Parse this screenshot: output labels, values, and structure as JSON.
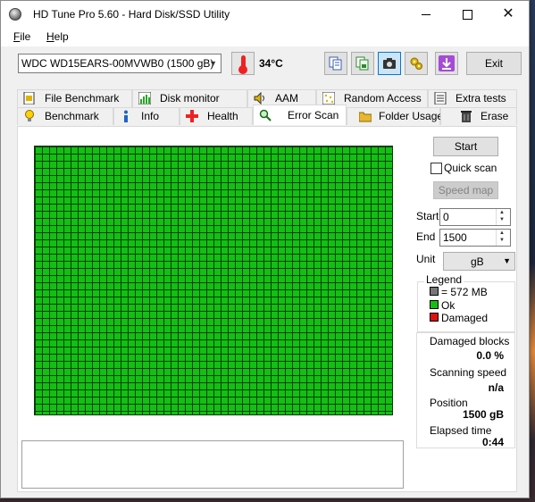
{
  "window": {
    "title": "HD Tune Pro 5.60 - Hard Disk/SSD Utility"
  },
  "menu": {
    "file_label": "File",
    "file_underline": "F",
    "file_rest": "ile",
    "help_label": "Help",
    "help_underline": "H",
    "help_rest": "elp"
  },
  "toolbar": {
    "drive": "WDC WD15EARS-00MVWB0 (1500 gB)",
    "temperature": "34°C",
    "exit_label": "Exit"
  },
  "tabs_top": [
    {
      "label": "File Benchmark",
      "icon": "file-benchmark-icon"
    },
    {
      "label": "Disk monitor",
      "icon": "disk-monitor-icon"
    },
    {
      "label": "AAM",
      "icon": "speaker-icon"
    },
    {
      "label": "Random Access",
      "icon": "random-access-icon"
    },
    {
      "label": "Extra tests",
      "icon": "extra-tests-icon"
    }
  ],
  "tabs_bottom": [
    {
      "label": "Benchmark",
      "icon": "lightbulb-icon"
    },
    {
      "label": "Info",
      "icon": "info-icon"
    },
    {
      "label": "Health",
      "icon": "health-cross-icon"
    },
    {
      "label": "Error Scan",
      "icon": "magnifier-icon",
      "selected": true
    },
    {
      "label": "Folder Usage",
      "icon": "folder-icon"
    },
    {
      "label": "Erase",
      "icon": "trash-icon"
    }
  ],
  "scan": {
    "start_label": "Start",
    "quick_scan_label": "Quick scan",
    "quick_scan_checked": false,
    "speed_map_label": "Speed map",
    "start_field_label": "Start",
    "start_value": "0",
    "end_field_label": "End",
    "end_value": "1500",
    "unit_label": "Unit",
    "unit_value": "gB",
    "block_state": "Ok",
    "block_color": "#12c012"
  },
  "legend": {
    "title": "Legend",
    "block_size": "= 572 MB",
    "ok_label": "Ok",
    "damaged_label": "Damaged",
    "colors": {
      "block": "#777777",
      "ok": "#12c012",
      "damaged": "#dd1111"
    }
  },
  "stats": {
    "damaged_blocks_label": "Damaged blocks",
    "damaged_blocks_value": "0.0 %",
    "scanning_speed_label": "Scanning speed",
    "scanning_speed_value": "n/a",
    "position_label": "Position",
    "position_value": "1500 gB",
    "elapsed_time_label": "Elapsed time",
    "elapsed_time_value": "0:44"
  }
}
